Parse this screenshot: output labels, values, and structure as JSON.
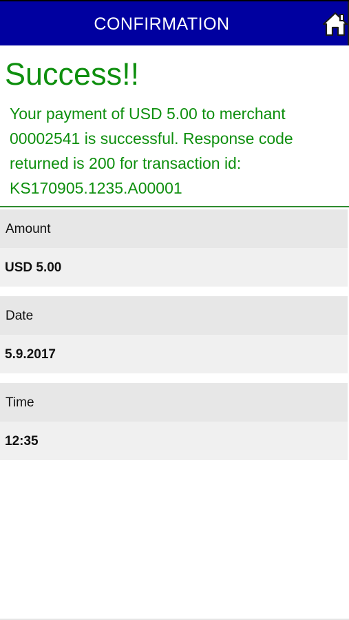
{
  "header": {
    "title": "CONFIRMATION",
    "home_icon": "home-icon",
    "background_color": "#0000a0"
  },
  "result": {
    "title": "Success!!",
    "message": "Your payment of USD 5.00 to merchant 00002541 is successful. Response code returned is 200 for transaction id: KS170905.1235.A00001",
    "text_color": "#0e8f0e"
  },
  "details": [
    {
      "label": "Amount",
      "value": "USD 5.00"
    },
    {
      "label": "Date",
      "value": "5.9.2017"
    },
    {
      "label": "Time",
      "value": "12:35"
    }
  ]
}
